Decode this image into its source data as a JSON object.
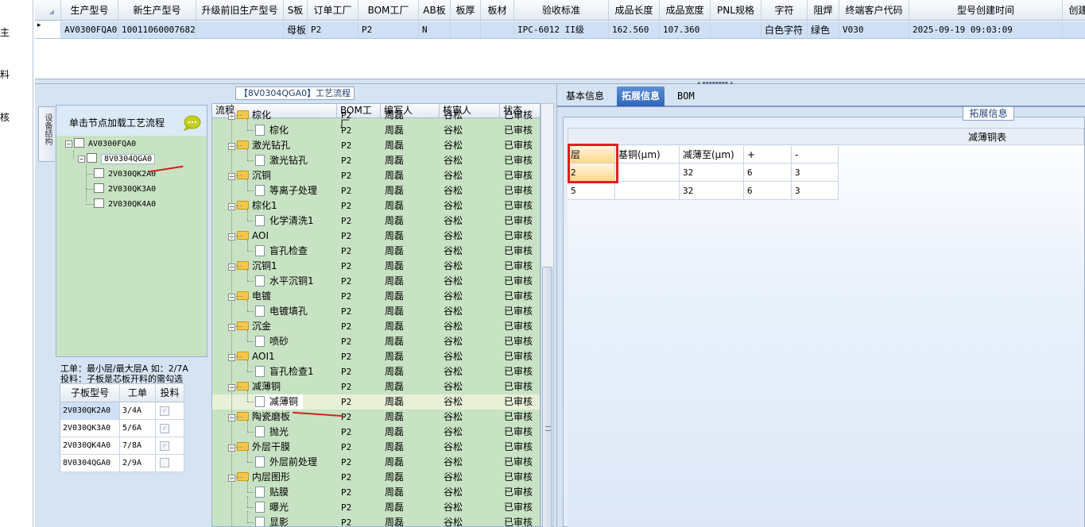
{
  "left_strip": {
    "chars": [
      "主",
      "料",
      "核"
    ]
  },
  "main_grid": {
    "columns": [
      "生产型号",
      "新生产型号",
      "升级前旧生产型号",
      "S板",
      "订单工厂",
      "BOM工厂",
      "AB板",
      "板厚",
      "板材",
      "验收标准",
      "成品长度",
      "成品宽度",
      "PNL规格",
      "字符",
      "阻焊",
      "终端客户代码",
      "型号创建时间",
      "创建"
    ],
    "row_marker": "▸",
    "row": [
      "AV0300FQA0",
      "10011060007682",
      "",
      "母板",
      "P2",
      "P2",
      "N",
      "",
      "",
      "IPC-6012 II级",
      "162.560",
      "107.360",
      "",
      "白色字符",
      "绿色",
      "V030",
      "2025-09-19 09:03:09",
      ""
    ]
  },
  "process_panel": {
    "title": "【8V0304QGA0】工艺流程",
    "vertical_tab": "设备结构"
  },
  "tree": {
    "header_text": "单击节点加载工艺流程",
    "nodes": [
      "AV0300FQA0",
      "8V0304QGA0",
      "2V030QK2A0",
      "2V030QK3A0",
      "2V030QK4A0"
    ]
  },
  "info": {
    "line1": "工单：最小层/最大层A 如：2/7A",
    "line2": "投料：子板是芯板开料的需勾选",
    "columns": [
      "子板型号",
      "工单",
      "投料"
    ],
    "rows": [
      {
        "model": "2V030QK2A0",
        "order": "3/4A",
        "feed": "✓"
      },
      {
        "model": "2V030QK3A0",
        "order": "5/6A",
        "feed": "✓"
      },
      {
        "model": "2V030QK4A0",
        "order": "7/8A",
        "feed": "✓"
      },
      {
        "model": "8V0304QGA0",
        "order": "2/9A",
        "feed": ""
      }
    ]
  },
  "flow_grid": {
    "columns": [
      "流程",
      "BOM工厂",
      "编写人",
      "核审人",
      "状态"
    ],
    "rows": [
      {
        "name": "棕化",
        "type": "folder",
        "bom": "P2",
        "writer": "周磊",
        "reviewer": "谷松",
        "status": "已审核"
      },
      {
        "name": "棕化",
        "type": "file",
        "bom": "P2",
        "writer": "周磊",
        "reviewer": "谷松",
        "status": "已审核"
      },
      {
        "name": "激光钻孔",
        "type": "folder",
        "bom": "P2",
        "writer": "周磊",
        "reviewer": "谷松",
        "status": "已审核"
      },
      {
        "name": "激光钻孔",
        "type": "file",
        "bom": "P2",
        "writer": "周磊",
        "reviewer": "谷松",
        "status": "已审核"
      },
      {
        "name": "沉铜",
        "type": "folder",
        "bom": "P2",
        "writer": "周磊",
        "reviewer": "谷松",
        "status": "已审核"
      },
      {
        "name": "等离子处理",
        "type": "file",
        "bom": "P2",
        "writer": "周磊",
        "reviewer": "谷松",
        "status": "已审核"
      },
      {
        "name": "棕化1",
        "type": "folder",
        "bom": "P2",
        "writer": "周磊",
        "reviewer": "谷松",
        "status": "已审核"
      },
      {
        "name": "化学清洗1",
        "type": "file",
        "bom": "P2",
        "writer": "周磊",
        "reviewer": "谷松",
        "status": "已审核"
      },
      {
        "name": "AOI",
        "type": "folder",
        "bom": "P2",
        "writer": "周磊",
        "reviewer": "谷松",
        "status": "已审核"
      },
      {
        "name": "盲孔检查",
        "type": "file",
        "bom": "P2",
        "writer": "周磊",
        "reviewer": "谷松",
        "status": "已审核"
      },
      {
        "name": "沉铜1",
        "type": "folder",
        "bom": "P2",
        "writer": "周磊",
        "reviewer": "谷松",
        "status": "已审核"
      },
      {
        "name": "水平沉铜1",
        "type": "file",
        "bom": "P2",
        "writer": "周磊",
        "reviewer": "谷松",
        "status": "已审核"
      },
      {
        "name": "电镀",
        "type": "folder",
        "bom": "P2",
        "writer": "周磊",
        "reviewer": "谷松",
        "status": "已审核"
      },
      {
        "name": "电镀填孔",
        "type": "file",
        "bom": "P2",
        "writer": "周磊",
        "reviewer": "谷松",
        "status": "已审核"
      },
      {
        "name": "沉金",
        "type": "folder",
        "bom": "P2",
        "writer": "周磊",
        "reviewer": "谷松",
        "status": "已审核"
      },
      {
        "name": "喷砂",
        "type": "file",
        "bom": "P2",
        "writer": "周磊",
        "reviewer": "谷松",
        "status": "已审核"
      },
      {
        "name": "AOI1",
        "type": "folder",
        "bom": "P2",
        "writer": "周磊",
        "reviewer": "谷松",
        "status": "已审核"
      },
      {
        "name": "盲孔检查1",
        "type": "file",
        "bom": "P2",
        "writer": "周磊",
        "reviewer": "谷松",
        "status": "已审核"
      },
      {
        "name": "减薄铜",
        "type": "folder",
        "bom": "P2",
        "writer": "周磊",
        "reviewer": "谷松",
        "status": "已审核"
      },
      {
        "name": "减薄铜",
        "type": "file",
        "bom": "P2",
        "writer": "周磊",
        "reviewer": "谷松",
        "status": "已审核",
        "selected": true
      },
      {
        "name": "陶瓷磨板",
        "type": "folder",
        "bom": "P2",
        "writer": "周磊",
        "reviewer": "谷松",
        "status": "已审核"
      },
      {
        "name": "抛光",
        "type": "file",
        "bom": "P2",
        "writer": "周磊",
        "reviewer": "谷松",
        "status": "已审核"
      },
      {
        "name": "外层干膜",
        "type": "folder",
        "bom": "P2",
        "writer": "周磊",
        "reviewer": "谷松",
        "status": "已审核"
      },
      {
        "name": "外层前处理",
        "type": "file",
        "bom": "P2",
        "writer": "周磊",
        "reviewer": "谷松",
        "status": "已审核"
      },
      {
        "name": "内层图形",
        "type": "folder",
        "bom": "P2",
        "writer": "周磊",
        "reviewer": "谷松",
        "status": "已审核"
      },
      {
        "name": "贴膜",
        "type": "file",
        "bom": "P2",
        "writer": "周磊",
        "reviewer": "谷松",
        "status": "已审核"
      },
      {
        "name": "曝光",
        "type": "file",
        "bom": "P2",
        "writer": "周磊",
        "reviewer": "谷松",
        "status": "已审核"
      },
      {
        "name": "显影",
        "type": "file",
        "bom": "P2",
        "writer": "周磊",
        "reviewer": "谷松",
        "status": "已审核"
      }
    ]
  },
  "right_panel": {
    "tabs": [
      "基本信息",
      "拓展信息",
      "BOM"
    ],
    "active_tab": 1,
    "group_title": "拓展信息",
    "table_caption": "减薄铜表",
    "columns": [
      "层",
      "基铜(μm)",
      "减薄至(μm)",
      "+",
      "-"
    ],
    "rows": [
      [
        "2",
        "",
        "32",
        "6",
        "3"
      ],
      [
        "5",
        "",
        "32",
        "6",
        "3"
      ]
    ]
  },
  "colors": {
    "tree_bg": "#c8e3c3",
    "panel_bg": "#d6e3f2",
    "selection": "#cfe0f6",
    "tab_active": "#2f64b8",
    "annotation_red": "#e02020"
  }
}
